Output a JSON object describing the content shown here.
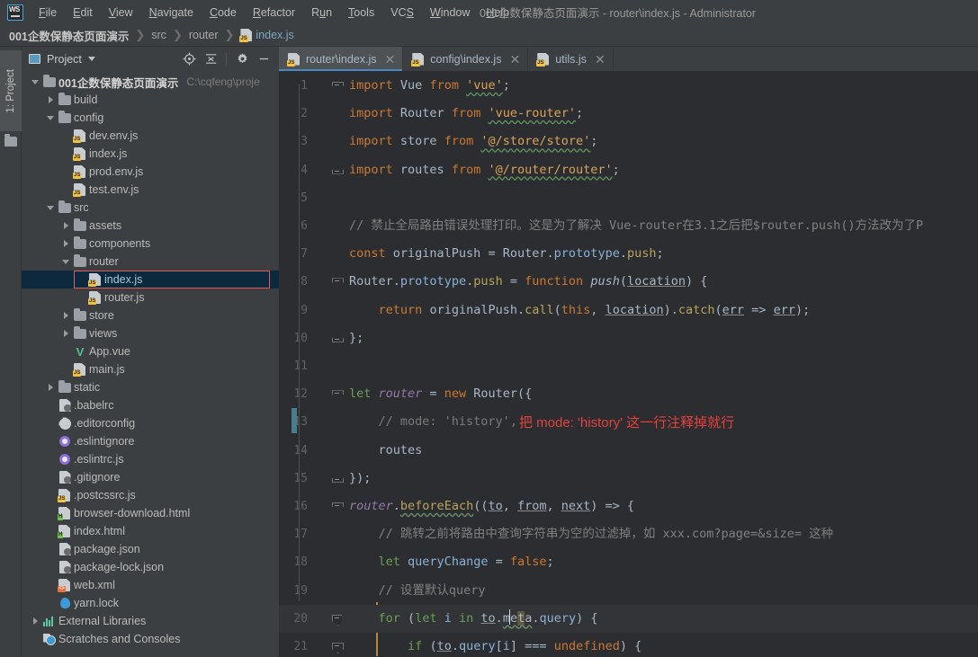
{
  "window": {
    "title": "001企数保静态页面演示 - router\\index.js - Administrator",
    "logo": "ws-logo"
  },
  "menubar": {
    "items": [
      {
        "label": "File"
      },
      {
        "label": "Edit"
      },
      {
        "label": "View"
      },
      {
        "label": "Navigate"
      },
      {
        "label": "Code"
      },
      {
        "label": "Refactor"
      },
      {
        "label": "Run"
      },
      {
        "label": "Tools"
      },
      {
        "label": "VCS"
      },
      {
        "label": "Window"
      },
      {
        "label": "Help"
      }
    ]
  },
  "breadcrumb": {
    "segments": [
      "001企数保静态页面演示",
      "src",
      "router",
      "index.js"
    ],
    "separator": "›"
  },
  "toolstrip": {
    "project_tab": "1: Project"
  },
  "project_panel": {
    "title": "Project",
    "tools": [
      "locate-icon",
      "collapse-all-icon",
      "settings-icon",
      "hide-icon"
    ],
    "tree": [
      {
        "label": "001企数保静态页面演示",
        "path": "C:\\cqfeng\\proje",
        "indent": 0,
        "arrow": "down",
        "icon": "folder",
        "bold": true
      },
      {
        "label": "build",
        "indent": 1,
        "arrow": "right",
        "icon": "folder"
      },
      {
        "label": "config",
        "indent": 1,
        "arrow": "down",
        "icon": "folder"
      },
      {
        "label": "dev.env.js",
        "indent": 2,
        "arrow": "none",
        "icon": "js"
      },
      {
        "label": "index.js",
        "indent": 2,
        "arrow": "none",
        "icon": "js"
      },
      {
        "label": "prod.env.js",
        "indent": 2,
        "arrow": "none",
        "icon": "js"
      },
      {
        "label": "test.env.js",
        "indent": 2,
        "arrow": "none",
        "icon": "js"
      },
      {
        "label": "src",
        "indent": 1,
        "arrow": "down",
        "icon": "folder"
      },
      {
        "label": "assets",
        "indent": 2,
        "arrow": "right",
        "icon": "folder"
      },
      {
        "label": "components",
        "indent": 2,
        "arrow": "right",
        "icon": "folder"
      },
      {
        "label": "router",
        "indent": 2,
        "arrow": "down",
        "icon": "folder"
      },
      {
        "label": "index.js",
        "indent": 3,
        "arrow": "none",
        "icon": "js",
        "selected": true,
        "boxed": true
      },
      {
        "label": "router.js",
        "indent": 3,
        "arrow": "none",
        "icon": "js"
      },
      {
        "label": "store",
        "indent": 2,
        "arrow": "right",
        "icon": "folder"
      },
      {
        "label": "views",
        "indent": 2,
        "arrow": "right",
        "icon": "folder"
      },
      {
        "label": "App.vue",
        "indent": 2,
        "arrow": "none",
        "icon": "vue"
      },
      {
        "label": "main.js",
        "indent": 2,
        "arrow": "none",
        "icon": "js"
      },
      {
        "label": "static",
        "indent": 1,
        "arrow": "right",
        "icon": "folder"
      },
      {
        "label": ".babelrc",
        "indent": 1,
        "arrow": "none",
        "icon": "json"
      },
      {
        "label": ".editorconfig",
        "indent": 1,
        "arrow": "none",
        "icon": "gear"
      },
      {
        "label": ".eslintignore",
        "indent": 1,
        "arrow": "none",
        "icon": "ring"
      },
      {
        "label": ".eslintrc.js",
        "indent": 1,
        "arrow": "none",
        "icon": "ring"
      },
      {
        "label": ".gitignore",
        "indent": 1,
        "arrow": "none",
        "icon": "json"
      },
      {
        "label": ".postcssrc.js",
        "indent": 1,
        "arrow": "none",
        "icon": "js"
      },
      {
        "label": "browser-download.html",
        "indent": 1,
        "arrow": "none",
        "icon": "html"
      },
      {
        "label": "index.html",
        "indent": 1,
        "arrow": "none",
        "icon": "html"
      },
      {
        "label": "package.json",
        "indent": 1,
        "arrow": "none",
        "icon": "json"
      },
      {
        "label": "package-lock.json",
        "indent": 1,
        "arrow": "none",
        "icon": "json"
      },
      {
        "label": "web.xml",
        "indent": 1,
        "arrow": "none",
        "icon": "xml"
      },
      {
        "label": "yarn.lock",
        "indent": 1,
        "arrow": "none",
        "icon": "lock"
      },
      {
        "label": "External Libraries",
        "indent": 0,
        "arrow": "right",
        "icon": "extlib"
      },
      {
        "label": "Scratches and Consoles",
        "indent": 0,
        "arrow": "none",
        "icon": "scratch"
      }
    ]
  },
  "editor": {
    "tabs": [
      {
        "label": "router\\index.js",
        "icon": "js",
        "active": true,
        "close": "✕"
      },
      {
        "label": "config\\index.js",
        "icon": "js",
        "active": false,
        "close": "✕"
      },
      {
        "label": "utils.js",
        "icon": "js",
        "active": false,
        "close": "✕"
      }
    ],
    "line_numbers": [
      "1",
      "2",
      "3",
      "4",
      "5",
      "6",
      "7",
      "8",
      "9",
      "10",
      "11",
      "12",
      "13",
      "14",
      "15",
      "16",
      "17",
      "18",
      "19",
      "20",
      "21"
    ],
    "annotation": "把 mode: 'history' 这一行注释掉就行",
    "annotation_color": "#e8413c"
  },
  "code_lines": {
    "l1_import": "import",
    "l1_vue": "Vue",
    "l1_from": "from",
    "l1_str": "'vue'",
    "l2_router": "Router",
    "l2_str": "'vue-router'",
    "l3_store": "store",
    "l3_str": "'@/store/store'",
    "l4_routes": "routes",
    "l4_str": "'@/router/router'",
    "l6_comment": "// 禁止全局路由错误处理打印。这是为了解决 Vue-router在3.1之后把$router.push()方法改为了P",
    "l7_const": "const",
    "l7_name": "originalPush",
    "l7_obj": "Router",
    "l7_proto": "prototype",
    "l7_push": "push",
    "l8_function": "function",
    "l8_fname": "push",
    "l8_arg": "location",
    "l9_return": "return",
    "l9_call": "call",
    "l9_this": "this",
    "l9_catch": "catch",
    "l9_err": "err",
    "l10": "};",
    "l12_let": "let",
    "l12_var": "router",
    "l12_new": "new",
    "l12_cls": "Router",
    "l13_comment": "// mode: 'history',",
    "l14_routes": "routes",
    "l15": "});",
    "l16_var": "router",
    "l16_method": "beforeEach",
    "l16_to": "to",
    "l16_from": "from",
    "l16_next": "next",
    "l17_comment": "// 跳转之前将路由中查询字符串为空的过滤掉，如 xxx.com?page=&size= 这种",
    "l18_let": "let",
    "l18_name": "queryChange",
    "l18_false": "false",
    "l19_comment": "// 设置默认query",
    "l20_for": "for",
    "l20_let": "let",
    "l20_i": "i",
    "l20_in": "in",
    "l20_to": "to",
    "l20_meta": "meta",
    "l20_query": "query",
    "l21_if": "if",
    "l21_to": "to",
    "l21_query": "query",
    "l21_i": "i",
    "l21_undef": "undefined"
  }
}
